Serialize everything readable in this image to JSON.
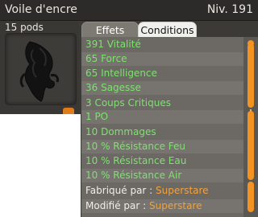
{
  "item": {
    "name": "Voile d'encre",
    "level": "Niv. 191",
    "weight": "15 pods"
  },
  "tabs": [
    {
      "label": "Effets",
      "active": true
    },
    {
      "label": "Conditions",
      "active": false
    }
  ],
  "effects": [
    "391 Vitalité",
    "65 Force",
    "65 Intelligence",
    "36 Sagesse",
    "3 Coups Critiques",
    "1 PO",
    "10 Dommages",
    "10 % Résistance Feu",
    "10 % Résistance Eau",
    "10 % Résistance Air"
  ],
  "crafted": {
    "label": "Fabriqué par : ",
    "author": "Superstare"
  },
  "modified": {
    "label": "Modifié par : ",
    "author": "Superstare"
  },
  "colors": {
    "effect_text": "#7ce26d",
    "author_text": "#f0a23e",
    "scrollbar": "#f39322"
  }
}
